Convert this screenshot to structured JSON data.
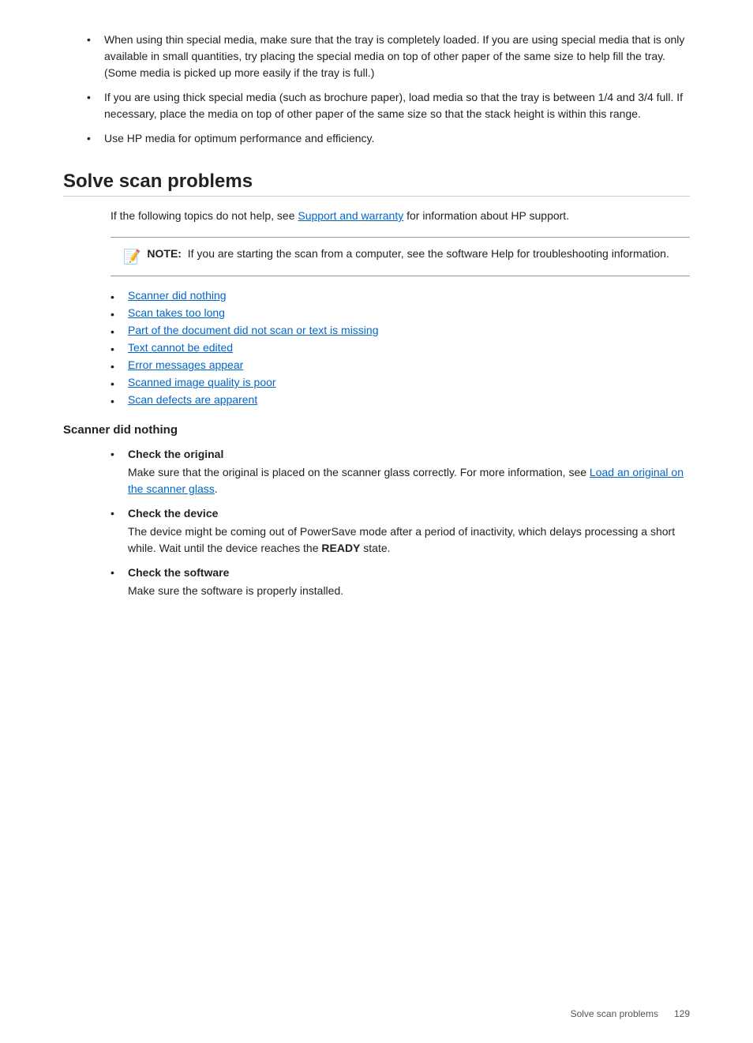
{
  "bullets_top": [
    {
      "text": "When using thin special media, make sure that the tray is completely loaded. If you are using special media that is only available in small quantities, try placing the special media on top of other paper of the same size to help fill the tray. (Some media is picked up more easily if the tray is full.)"
    },
    {
      "text": "If you are using thick special media (such as brochure paper), load media so that the tray is between 1/4 and 3/4 full. If necessary, place the media on top of other paper of the same size so that the stack height is within this range."
    },
    {
      "text": "Use HP media for optimum performance and efficiency."
    }
  ],
  "section_title": "Solve scan problems",
  "intro_text": "If the following topics do not help, see ",
  "intro_link_text": "Support and warranty",
  "intro_text2": " for information about HP support.",
  "note_label": "NOTE:",
  "note_text": "If you are starting the scan from a computer, see the software Help for troubleshooting information.",
  "link_list": [
    {
      "text": "Scanner did nothing",
      "href": "#"
    },
    {
      "text": "Scan takes too long",
      "href": "#"
    },
    {
      "text": "Part of the document did not scan or text is missing",
      "href": "#"
    },
    {
      "text": "Text cannot be edited",
      "href": "#"
    },
    {
      "text": "Error messages appear",
      "href": "#"
    },
    {
      "text": "Scanned image quality is poor",
      "href": "#"
    },
    {
      "text": "Scan defects are apparent",
      "href": "#"
    }
  ],
  "subsection_title": "Scanner did nothing",
  "subsection_items": [
    {
      "title": "Check the original",
      "desc": "Make sure that the original is placed on the scanner glass correctly. For more information, see ",
      "desc_link": "Load an original on the scanner glass",
      "desc_after": "."
    },
    {
      "title": "Check the device",
      "desc": "The device might be coming out of PowerSave mode after a period of inactivity, which delays processing a short while. Wait until the device reaches the ",
      "desc_bold": "READY",
      "desc_after": " state."
    },
    {
      "title": "Check the software",
      "desc": "Make sure the software is properly installed.",
      "desc_link": "",
      "desc_after": ""
    }
  ],
  "footer_text": "Solve scan problems",
  "footer_page": "129"
}
